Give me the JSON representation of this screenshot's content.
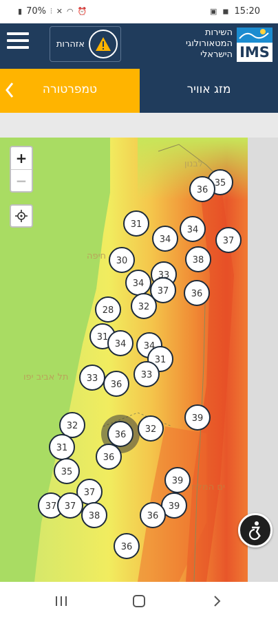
{
  "status_bar": {
    "battery": "70%",
    "time": "15:20"
  },
  "header": {
    "alerts_label": "אזהרות",
    "brand_line1": "השירות",
    "brand_line2": "המטאורולוגי",
    "brand_line3": "הישראלי",
    "logo_text": "IMS"
  },
  "tabs": {
    "temperature_label": "טמפרטורה",
    "weather_label": "מזג אוויר"
  },
  "map": {
    "zoom_in": "+",
    "zoom_out": "−",
    "place_labels": [
      "לבנון",
      "חיפה",
      "תל אביב יפו",
      "ים המלח"
    ],
    "markers": [
      {
        "value": "35"
      },
      {
        "value": "36"
      },
      {
        "value": "31"
      },
      {
        "value": "34"
      },
      {
        "value": "34"
      },
      {
        "value": "37"
      },
      {
        "value": "30"
      },
      {
        "value": "38"
      },
      {
        "value": "33"
      },
      {
        "value": "34"
      },
      {
        "value": "37"
      },
      {
        "value": "36"
      },
      {
        "value": "28"
      },
      {
        "value": "32"
      },
      {
        "value": "31"
      },
      {
        "value": "34"
      },
      {
        "value": "34"
      },
      {
        "value": "31"
      },
      {
        "value": "33"
      },
      {
        "value": "36"
      },
      {
        "value": "33"
      },
      {
        "value": "39"
      },
      {
        "value": "32"
      },
      {
        "value": "36",
        "selected": true
      },
      {
        "value": "32"
      },
      {
        "value": "31"
      },
      {
        "value": "36"
      },
      {
        "value": "35"
      },
      {
        "value": "39"
      },
      {
        "value": "37"
      },
      {
        "value": "37"
      },
      {
        "value": "37"
      },
      {
        "value": "39"
      },
      {
        "value": "38"
      },
      {
        "value": "36"
      },
      {
        "value": "36"
      }
    ]
  },
  "colors": {
    "header_bg": "#203c5c",
    "temperature_tab": "#ffb400",
    "brand_blue": "#1b8cd0"
  },
  "icons": [
    "menu-icon",
    "warning-icon",
    "chevron-left-icon",
    "locate-icon",
    "accessibility-icon",
    "recent-apps-icon",
    "home-icon",
    "back-icon"
  ]
}
